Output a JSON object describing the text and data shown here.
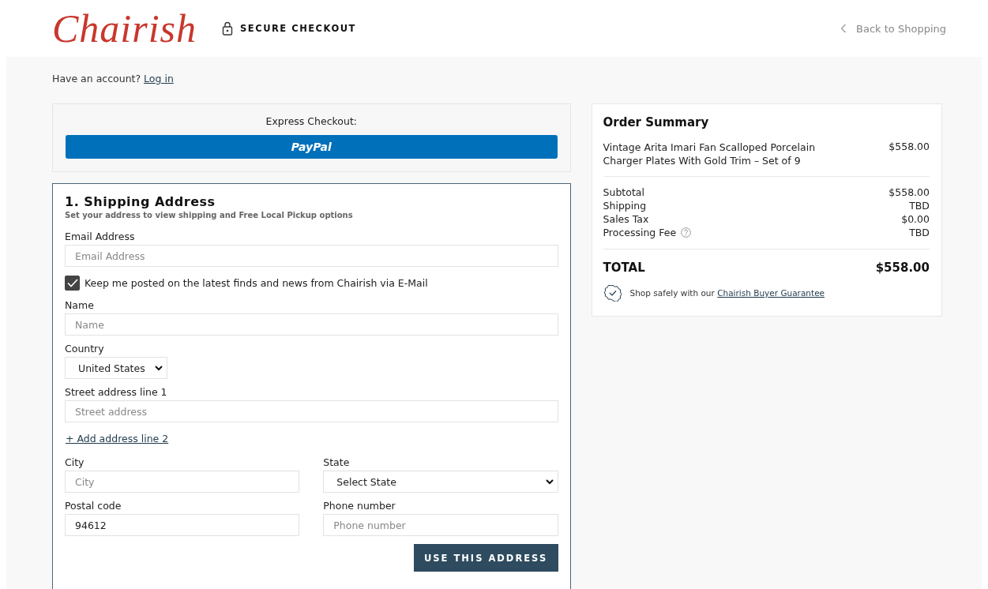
{
  "header": {
    "logo": "Chairish",
    "secure_label": "SECURE CHECKOUT",
    "back_link": "Back to Shopping"
  },
  "account": {
    "prompt": "Have an account?",
    "link": "Log in"
  },
  "express": {
    "label": "Express Checkout:",
    "button": "PayPal"
  },
  "shipping": {
    "title": "1. Shipping Address",
    "subtitle": "Set your address to view shipping and Free Local Pickup options",
    "rows": [
      [
        {
          "kind": "input",
          "label": "Email Address",
          "placeholder": "Email Address"
        }
      ],
      [
        {
          "kind": "checkbox",
          "label": "Keep me posted on the latest finds and news from Chairish via E-Mail",
          "checked": true
        }
      ],
      [
        {
          "kind": "input",
          "label": "Name",
          "placeholder": "Name"
        }
      ],
      [
        {
          "kind": "select",
          "label": "Country",
          "value": "United States"
        }
      ],
      [
        {
          "kind": "input",
          "label": "Street address line 1",
          "placeholder": "Street address"
        }
      ],
      [
        {
          "kind": "link",
          "label": "+ Add address line 2"
        }
      ],
      [
        {
          "kind": "input",
          "label": "City",
          "placeholder": "City"
        },
        {
          "kind": "select",
          "label": "State",
          "value": "Select State"
        }
      ],
      [
        {
          "kind": "input",
          "label": "Postal code",
          "value": "94612"
        },
        {
          "kind": "input",
          "label": "Phone number",
          "placeholder": "Phone number"
        }
      ]
    ],
    "submit": "USE THIS ADDRESS"
  },
  "summary": {
    "title": "Order Summary",
    "items": [
      {
        "name": "Vintage Arita Imari Fan Scalloped Porcelain Charger Plates With Gold Trim – Set of 9",
        "price": "$558.00"
      }
    ],
    "lines": [
      {
        "label": "Subtotal",
        "value": "$558.00",
        "help": false
      },
      {
        "label": "Shipping",
        "value": "TBD",
        "help": false
      },
      {
        "label": "Sales Tax",
        "value": "$0.00",
        "help": false
      },
      {
        "label": "Processing Fee",
        "value": "TBD",
        "help": true
      }
    ],
    "total": {
      "label": "TOTAL",
      "value": "$558.00"
    },
    "guarantee": {
      "text": "Shop safely with our",
      "link": "Chairish Buyer Guarantee"
    }
  }
}
